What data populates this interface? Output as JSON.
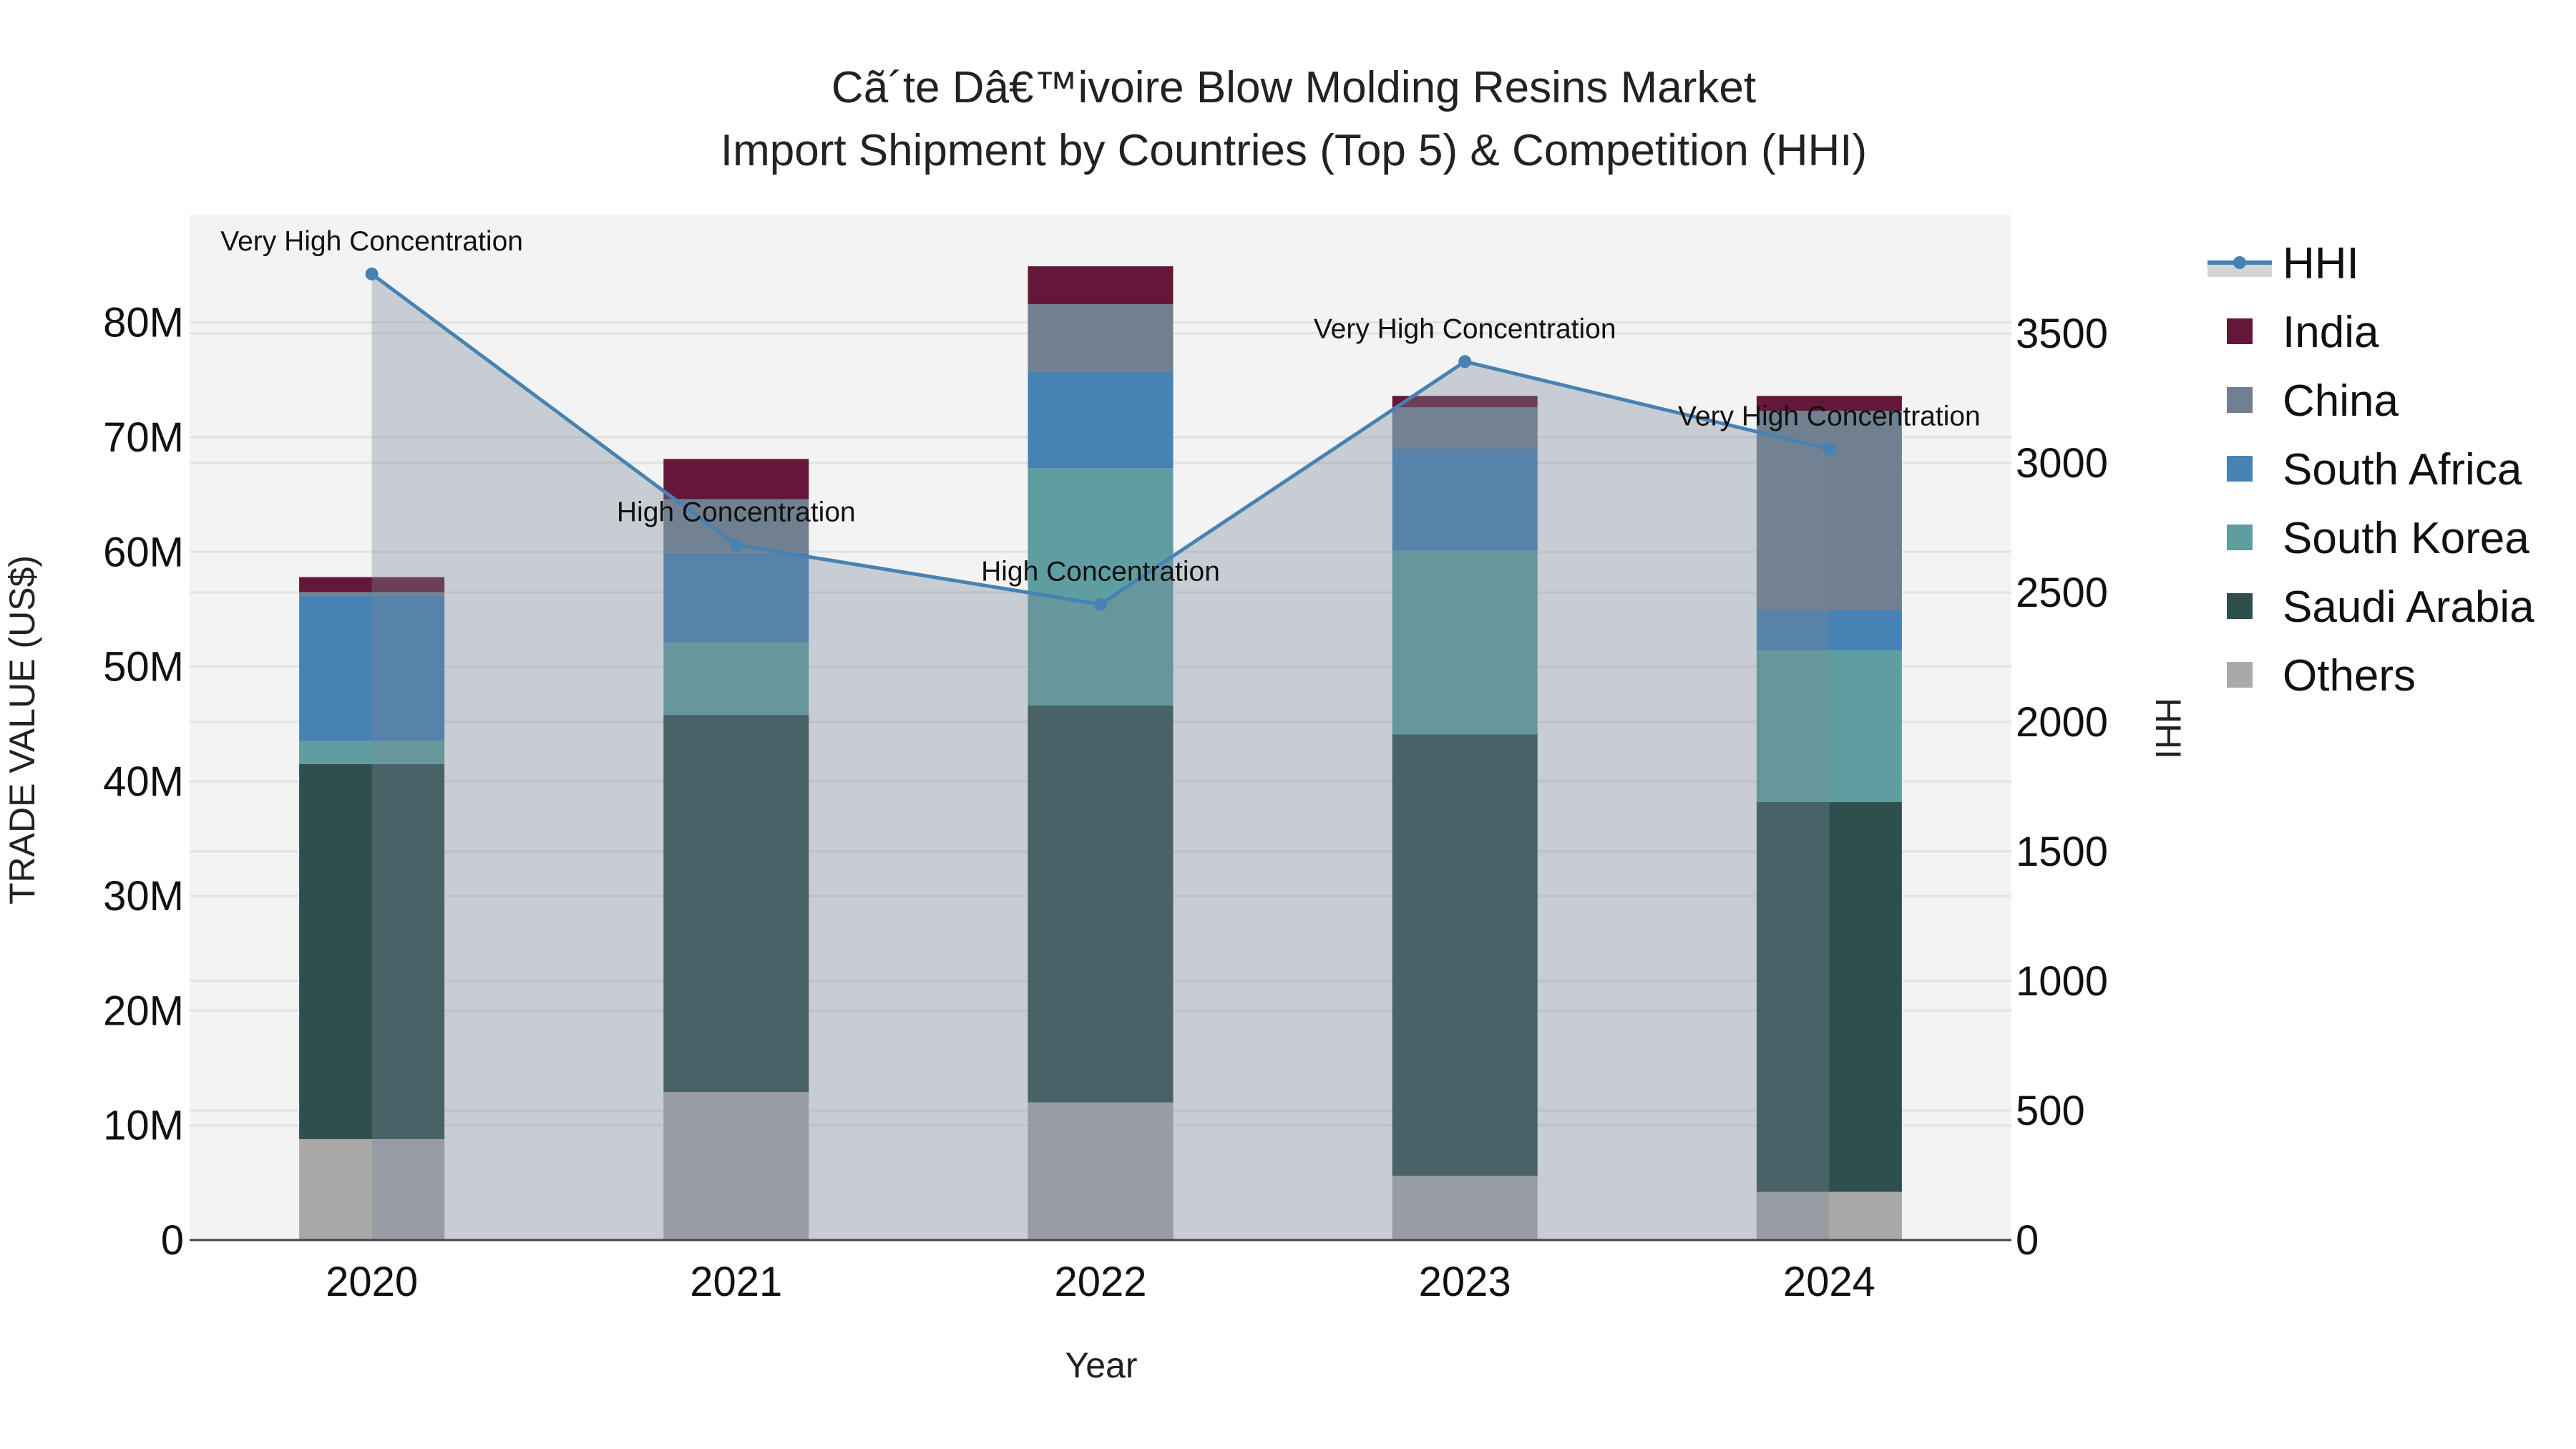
{
  "chart_data": {
    "type": "bar",
    "title": "Cã´te Dâ€™ivoire Blow Molding Resins Market",
    "subtitle": "Import Shipment by Countries (Top 5) & Competition (HHI)",
    "xlabel": "Year",
    "ylabel": "TRADE VALUE (US$)",
    "y2label": "HHI",
    "categories": [
      "2020",
      "2021",
      "2022",
      "2023",
      "2024"
    ],
    "ylim": [
      0,
      89400000
    ],
    "y2lim": [
      0,
      3958
    ],
    "yticks": [
      0,
      10000000,
      20000000,
      30000000,
      40000000,
      50000000,
      60000000,
      70000000,
      80000000
    ],
    "ytick_labels": [
      "0",
      "10M",
      "20M",
      "30M",
      "40M",
      "50M",
      "60M",
      "70M",
      "80M"
    ],
    "y2ticks": [
      0,
      500,
      1000,
      1500,
      2000,
      2500,
      3000,
      3500
    ],
    "y2tick_labels": [
      "0",
      "500",
      "1000",
      "1500",
      "2000",
      "2500",
      "3000",
      "3500"
    ],
    "grid": true,
    "legend_placement": "right",
    "stacked": true,
    "series": [
      {
        "name": "Others",
        "color": "#A9A9A9",
        "values": [
          8800000,
          12900000,
          12000000,
          5600000,
          4200000
        ]
      },
      {
        "name": "Saudi Arabia",
        "color": "#2F4F4F",
        "values": [
          32700000,
          32900000,
          34600000,
          38500000,
          34000000
        ]
      },
      {
        "name": "South Korea",
        "color": "#5F9EA0",
        "values": [
          2000000,
          6300000,
          20700000,
          16000000,
          13200000
        ]
      },
      {
        "name": "South Africa",
        "color": "#4682B4",
        "values": [
          12700000,
          7800000,
          8400000,
          8900000,
          3500000
        ]
      },
      {
        "name": "China",
        "color": "#708090",
        "values": [
          300000,
          4700000,
          5900000,
          3600000,
          17400000
        ]
      },
      {
        "name": "India",
        "color": "#641739",
        "values": [
          1300000,
          3500000,
          3300000,
          1000000,
          1300000
        ]
      }
    ],
    "hhi": {
      "name": "HHI",
      "color": "#4682B4",
      "values": [
        3729,
        2683,
        2454,
        3391,
        3053
      ],
      "annotations": [
        "Very High Concentration",
        "High Concentration",
        "High Concentration",
        "Very High Concentration",
        "Very High Concentration"
      ]
    },
    "legend_order": [
      "HHI",
      "India",
      "China",
      "South Africa",
      "South Korea",
      "Saudi Arabia",
      "Others"
    ]
  }
}
